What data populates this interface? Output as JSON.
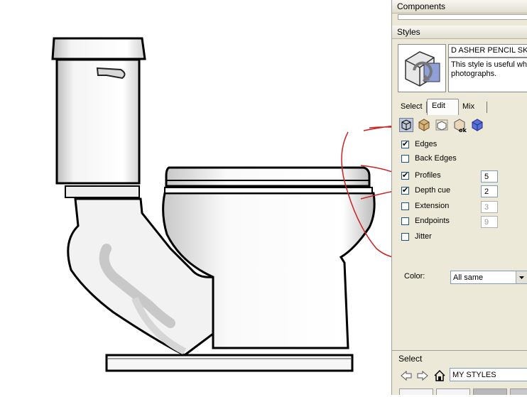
{
  "panel": {
    "components_title": "Components",
    "styles_title": "Styles",
    "style_name": "D ASHER PENCIL SKET",
    "style_description": "This style is useful whe photographs.",
    "tabs": [
      {
        "label": "Select"
      },
      {
        "label": "Edit"
      },
      {
        "label": "Mix"
      }
    ],
    "edit_icons": [
      "edge-settings-icon",
      "face-settings-icon",
      "background-settings-icon",
      "watermark-settings-icon",
      "modeling-settings-icon"
    ],
    "edge_options": [
      {
        "label": "Edges",
        "checked": true
      },
      {
        "label": "Back Edges",
        "checked": false
      },
      {
        "label": "Profiles",
        "checked": true,
        "value": "5"
      },
      {
        "label": "Depth cue",
        "checked": true,
        "value": "2"
      },
      {
        "label": "Extension",
        "checked": false,
        "value": "3"
      },
      {
        "label": "Endpoints",
        "checked": false,
        "value": "9"
      },
      {
        "label": "Jitter",
        "checked": false
      }
    ],
    "color_label": "Color:",
    "color_value": "All same",
    "select_section_title": "Select",
    "collection_value": "MY STYLES"
  },
  "annotation_color": "#cc2222"
}
